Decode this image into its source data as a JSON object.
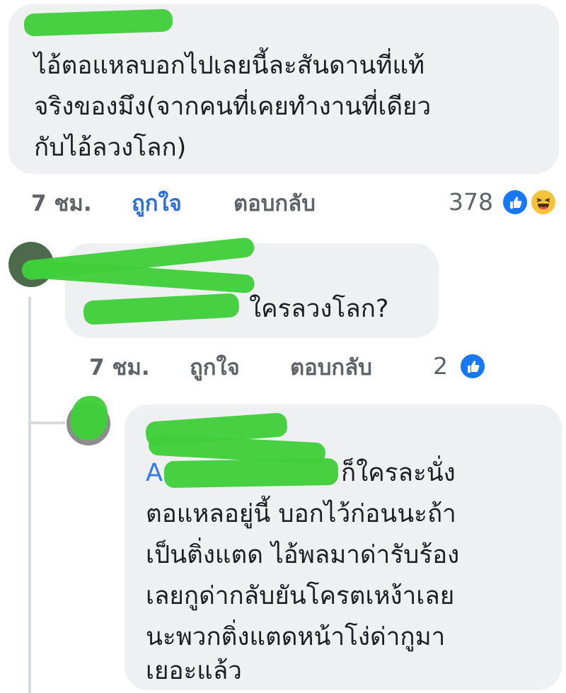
{
  "comments": [
    {
      "text_lines": [
        "ไอ้ตอแหลบอกไปเลยนี้ละสันดานที่แท้",
        "จริงของมึง(จากคนที่เคยทำงานที่เดียว",
        "กับไอ้ลวงโลก)"
      ],
      "time": "7 ชม.",
      "like_label": "ถูกใจ",
      "reply_label": "ตอบกลับ",
      "reaction_count": "378",
      "reactions": [
        "like-icon",
        "haha-icon"
      ]
    },
    {
      "text": "ใครลวงโลก?",
      "time": "7 ชม.",
      "like_label": "ถูกใจ",
      "reply_label": "ตอบกลับ",
      "reaction_count": "2",
      "reactions": [
        "like-icon"
      ]
    },
    {
      "mention_partial": "A",
      "text_lines": [
        "ก็ใครละนั่ง",
        "ตอแหลอยู่นี้ บอกไว้ก่อนนะถ้า",
        "เป็นติ่งแตด ไอ้พลมาด่ารับร้อง",
        "เลยกูด่ากลับยันโครตเหง้าเลย",
        "นะพวกติ่งแตดหน้าโง่ด่ากูมา",
        "เยอะแล้ว"
      ]
    }
  ],
  "colors": {
    "bubble": "#eef0f2",
    "link_blue": "#3579e6",
    "like_blue": "#1877f2",
    "redaction_green": "#3fcf3a",
    "meta_gray": "#5f6368"
  }
}
